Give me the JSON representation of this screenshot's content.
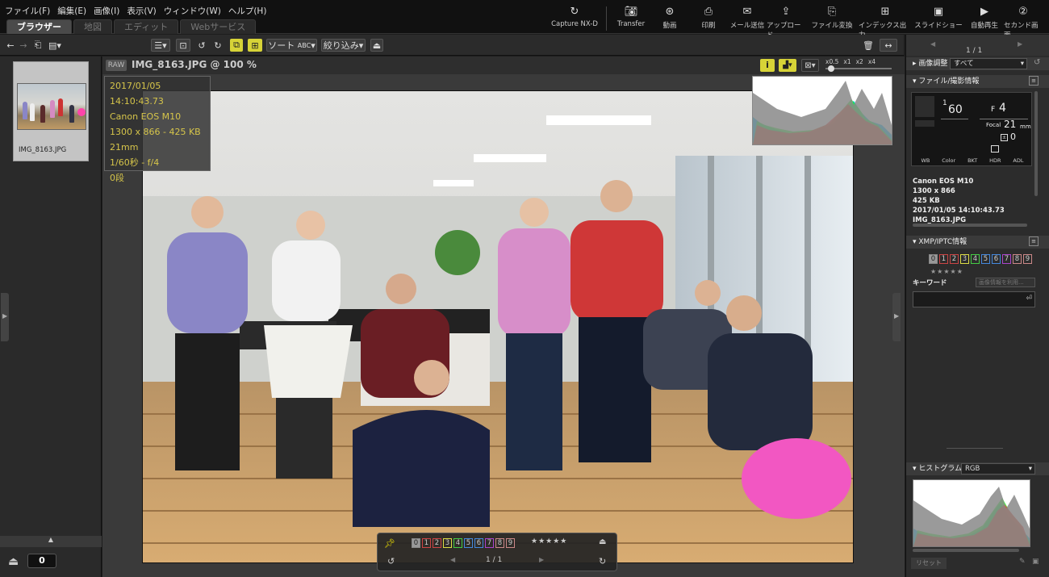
{
  "menu": [
    "ファイル(F)",
    "編集(E)",
    "画像(I)",
    "表示(V)",
    "ウィンドウ(W)",
    "ヘルプ(H)"
  ],
  "tabs": [
    "ブラウザー",
    "地図",
    "エディット",
    "Webサービス"
  ],
  "top_buttons": [
    {
      "label": "Capture NX-D",
      "icon": "capture-nxd-icon"
    },
    {
      "label": "Transfer",
      "icon": "camera-transfer-icon"
    },
    {
      "label": "動画",
      "icon": "movie-icon"
    },
    {
      "label": "印刷",
      "icon": "print-icon"
    },
    {
      "label": "メール送信",
      "icon": "mail-icon"
    },
    {
      "label": "アップロード",
      "icon": "upload-icon"
    },
    {
      "label": "ファイル変換",
      "icon": "file-convert-icon"
    },
    {
      "label": "インデックス出力",
      "icon": "index-print-icon"
    },
    {
      "label": "スライドショー",
      "icon": "slideshow-icon"
    },
    {
      "label": "自動再生",
      "icon": "autoplay-icon"
    },
    {
      "label": "セカンド画面",
      "icon": "second-screen-icon"
    }
  ],
  "toolbar": {
    "sort": "ソート",
    "sort_sub": "ABC",
    "filter": "絞り込み"
  },
  "thumbnail": {
    "filename": "IMG_8163.JPG"
  },
  "left_counter": "0",
  "viewer": {
    "raw_badge": "RAW",
    "filename": "IMG_8163.JPG @ 100 %",
    "zoom_labels": [
      "x0.5",
      "x1",
      "x2",
      "x4"
    ]
  },
  "info_overlay": [
    "2017/01/05 14:10:43.73",
    "Canon EOS M10",
    "1300 x 866 - 425 KB",
    "21mm",
    "1/60秒 - f/4",
    "0段"
  ],
  "bottom": {
    "labels": [
      "0",
      "1",
      "2",
      "3",
      "4",
      "5",
      "6",
      "7",
      "8",
      "9"
    ],
    "page": "1 / 1",
    "stars": "★★★★★"
  },
  "right": {
    "page_counter": "1 / 1",
    "adjust_label": "画像調整",
    "adjust_value": "すべて",
    "file_section": "ファイル/撮影情報",
    "shutter_num": "1",
    "shutter_den": "60",
    "f_label": "F",
    "f_value": "4",
    "focal_label": "Focal",
    "focal_value": "21",
    "focal_unit": "mm",
    "ev": "0",
    "cam_tabs": [
      "WB",
      "Color",
      "BKT",
      "HDR",
      "ADL"
    ],
    "meta_lines": [
      "Canon EOS M10",
      "1300 x 866",
      "425 KB",
      "2017/01/05 14:10:43.73",
      "IMG_8163.JPG"
    ],
    "xmp_section": "XMP/IPTC情報",
    "labels": [
      "0",
      "1",
      "2",
      "3",
      "4",
      "5",
      "6",
      "7",
      "8",
      "9"
    ],
    "keyword_label": "キーワード",
    "keyword_placeholder": "画像情報を利用...",
    "histo_section": "ヒストグラム",
    "histo_mode": "RGB",
    "reset": "リセット"
  }
}
